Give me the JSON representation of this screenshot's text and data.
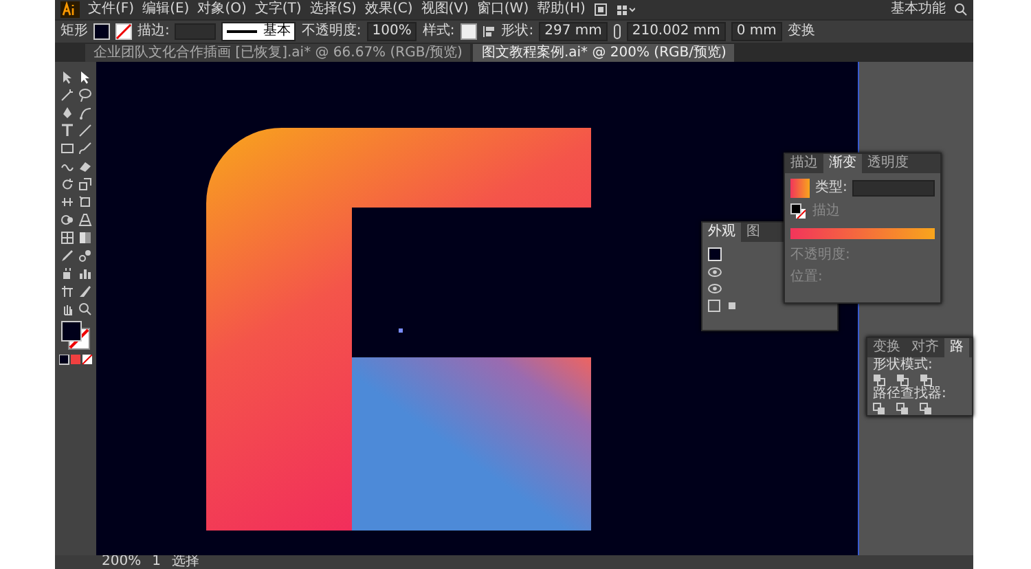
{
  "menu": [
    "文件(F)",
    "编辑(E)",
    "对象(O)",
    "文字(T)",
    "选择(S)",
    "效果(C)",
    "视图(V)",
    "窗口(W)",
    "帮助(H)"
  ],
  "workspace": "基本功能",
  "control_bar": {
    "object_type": "矩形",
    "stroke_label": "描边:",
    "brush": "基本",
    "opacity_label": "不透明度:",
    "opacity": "100%",
    "style_label": "样式:",
    "shape_label": "形状:",
    "width": "297 mm",
    "height": "210.002 mm",
    "corner": "0 mm",
    "transform": "变换"
  },
  "document_tabs": [
    {
      "title": "企业团队文化合作插画 [已恢复].ai* @ 66.67% (RGB/预览)",
      "selected": false
    },
    {
      "title": "图文教程案例.ai* @ 200% (RGB/预览)",
      "selected": true
    }
  ],
  "layers_panel": {
    "tabs": [
      {
        "label": "外观",
        "selected": true
      },
      {
        "label": "图",
        "selected": false
      }
    ]
  },
  "gradient_panel": {
    "tabs": [
      {
        "label": "描边",
        "selected": false
      },
      {
        "label": "渐变",
        "selected": true
      },
      {
        "label": "透明度",
        "selected": false
      }
    ],
    "type_label": "类型:",
    "stroke_label": "描边",
    "opacity_label": "不透明度:",
    "position_label": "位置:"
  },
  "pathfinder_panel": {
    "tabs": [
      {
        "label": "变换",
        "selected": false
      },
      {
        "label": "对齐",
        "selected": false
      },
      {
        "label": "路",
        "selected": true
      }
    ],
    "shape_modes_label": "形状模式:",
    "pathfinders_label": "路径查找器:"
  },
  "status_bar": {
    "zoom": "200%",
    "artboard": "1",
    "tool": "选择"
  }
}
